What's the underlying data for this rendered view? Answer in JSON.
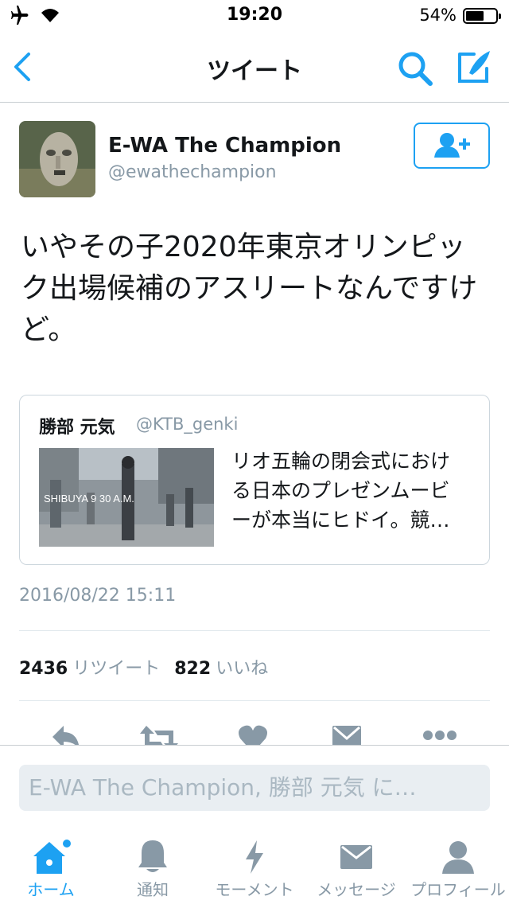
{
  "status_bar": {
    "time": "19:20",
    "battery_percent": "54%",
    "battery_level": 0.54
  },
  "nav": {
    "title": "ツイート"
  },
  "tweet": {
    "author_name": "E-WA The Champion",
    "author_handle": "@ewathechampion",
    "text": "いやその子2020年東京オリンピック出場候補のアスリートなんですけど。",
    "timestamp": "2016/08/22 15:11",
    "retweet_count": "2436",
    "retweet_label": "リツイート",
    "like_count": "822",
    "like_label": "いいね"
  },
  "quoted_tweet": {
    "author_name": "勝部 元気",
    "author_handle": "@KTB_genki",
    "text_lines": [
      "リオ五輪の閉会式におけ",
      "る日本のプレゼンムービ",
      "ーが本当にヒドイ。競…"
    ],
    "thumbnail_caption": "SHIBUYA 9 30 A.M."
  },
  "reply": {
    "placeholder": "E-WA The Champion, 勝部 元気 に…"
  },
  "tab_bar": {
    "items": [
      {
        "label": "ホーム",
        "icon": "home-icon"
      },
      {
        "label": "通知",
        "icon": "bell-icon"
      },
      {
        "label": "モーメント",
        "icon": "lightning-icon"
      },
      {
        "label": "メッセージ",
        "icon": "envelope-icon"
      },
      {
        "label": "プロフィール",
        "icon": "person-icon"
      }
    ]
  },
  "colors": {
    "accent": "#1da1f2",
    "muted": "#8899a6",
    "text": "#14171a"
  }
}
